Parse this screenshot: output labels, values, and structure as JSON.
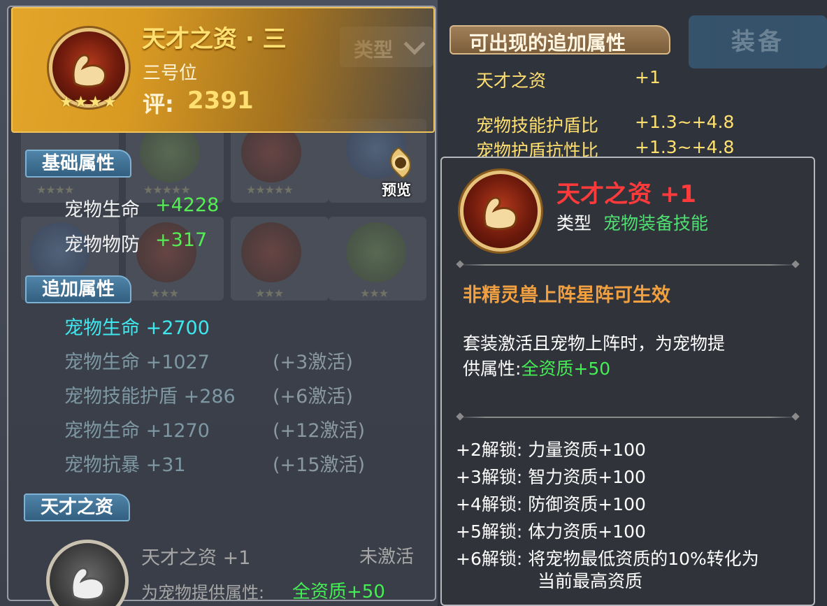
{
  "left_panel": {
    "header": {
      "title": "天才之资 · 三",
      "position": "三号位",
      "score_label": "评:",
      "score_value": "2391",
      "stars": 4
    },
    "filter_label": "类型",
    "preview_label": "预览",
    "base_section": {
      "label": "基础属性",
      "rows": [
        {
          "name": "宠物生命",
          "value": "+4228"
        },
        {
          "name": "宠物物防",
          "value": "+317"
        }
      ]
    },
    "add_section": {
      "label": "追加属性",
      "rows": [
        {
          "text": "宠物生命 +2700",
          "cond": ""
        },
        {
          "text": "宠物生命 +1027",
          "cond": "(+3激活)"
        },
        {
          "text": "宠物技能护盾 +286",
          "cond": "(+6激活)"
        },
        {
          "text": "宠物生命 +1270",
          "cond": "(+12激活)"
        },
        {
          "text": "宠物抗暴 +31",
          "cond": "(+15激活)"
        }
      ]
    },
    "talent_section": {
      "label": "天才之资",
      "skill_name": "天才之资 +1",
      "status": "未激活",
      "desc_prefix": "为宠物提供属性:",
      "desc_value": "全资质+50"
    }
  },
  "right_panel": {
    "title": "可出现的追加属性",
    "equip_button": "装备",
    "rows": [
      {
        "name": "天才之资",
        "value": "+1"
      },
      {
        "name": "宠物技能护盾比",
        "value": "+1.3~+4.8"
      },
      {
        "name": "宠物护盾抗性比",
        "value": "+1.3~+4.8"
      }
    ]
  },
  "tooltip": {
    "title": "天才之资 +1",
    "type_label": "类型",
    "type_value": "宠物装备技能",
    "condition": "非精灵兽上阵星阵可生效",
    "desc_line1": "套装激活且宠物上阵时，为宠物提",
    "desc_line2_prefix": "供属性:",
    "desc_line2_value": "全资质+50",
    "unlocks": [
      {
        "text": "+2解锁:  力量资质+100"
      },
      {
        "text": "+3解锁:  智力资质+100"
      },
      {
        "text": "+4解锁:  防御资质+100"
      },
      {
        "text": "+5解锁:  体力资质+100"
      },
      {
        "text": "+6解锁:  将宠物最低资质的10%转化为"
      }
    ],
    "unlock_cont": "当前最高资质"
  },
  "colors": {
    "gold": "#ffe070",
    "green": "#55ee55",
    "cyan": "#3ee8ee",
    "red_title": "#ff3a3a",
    "orange_cond": "#f0a040"
  }
}
